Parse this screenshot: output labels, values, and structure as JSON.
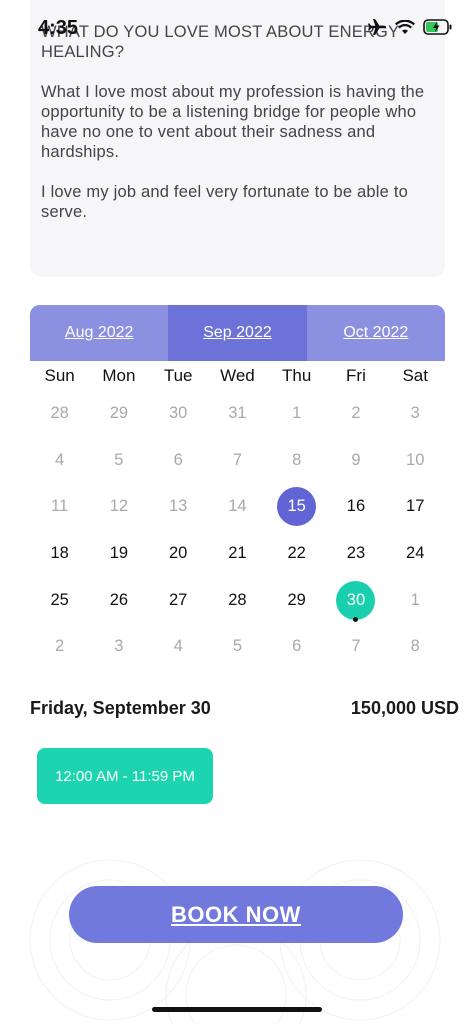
{
  "status": {
    "time": "4:35"
  },
  "bio": {
    "heading": "WHAT DO YOU LOVE MOST ABOUT ENERGY HEALING?",
    "paragraph1": "What I love most about my profession is having the opportunity to be a listening bridge for people who have no one to vent about their sadness and hardships.",
    "paragraph2": "I love my job and feel very fortunate to be able to serve."
  },
  "calendar": {
    "prev_month": "Aug 2022",
    "current_month": "Sep 2022",
    "next_month": "Oct 2022",
    "weekdays": [
      "Sun",
      "Mon",
      "Tue",
      "Wed",
      "Thu",
      "Fri",
      "Sat"
    ],
    "weeks": [
      [
        {
          "d": "28",
          "s": "muted"
        },
        {
          "d": "29",
          "s": "muted"
        },
        {
          "d": "30",
          "s": "muted"
        },
        {
          "d": "31",
          "s": "muted"
        },
        {
          "d": "1",
          "s": "muted"
        },
        {
          "d": "2",
          "s": "muted"
        },
        {
          "d": "3",
          "s": "muted"
        }
      ],
      [
        {
          "d": "4",
          "s": "muted"
        },
        {
          "d": "5",
          "s": "muted"
        },
        {
          "d": "6",
          "s": "muted"
        },
        {
          "d": "7",
          "s": "muted"
        },
        {
          "d": "8",
          "s": "muted"
        },
        {
          "d": "9",
          "s": "muted"
        },
        {
          "d": "10",
          "s": "muted"
        }
      ],
      [
        {
          "d": "11",
          "s": "muted"
        },
        {
          "d": "12",
          "s": "muted"
        },
        {
          "d": "13",
          "s": "muted"
        },
        {
          "d": "14",
          "s": "muted"
        },
        {
          "d": "15",
          "s": "today"
        },
        {
          "d": "16",
          "s": "normal"
        },
        {
          "d": "17",
          "s": "normal"
        }
      ],
      [
        {
          "d": "18",
          "s": "normal"
        },
        {
          "d": "19",
          "s": "normal"
        },
        {
          "d": "20",
          "s": "normal"
        },
        {
          "d": "21",
          "s": "normal"
        },
        {
          "d": "22",
          "s": "normal"
        },
        {
          "d": "23",
          "s": "normal"
        },
        {
          "d": "24",
          "s": "normal"
        }
      ],
      [
        {
          "d": "25",
          "s": "normal"
        },
        {
          "d": "26",
          "s": "normal"
        },
        {
          "d": "27",
          "s": "normal"
        },
        {
          "d": "28",
          "s": "normal"
        },
        {
          "d": "29",
          "s": "normal"
        },
        {
          "d": "30",
          "s": "selected"
        },
        {
          "d": "1",
          "s": "muted"
        }
      ],
      [
        {
          "d": "2",
          "s": "muted"
        },
        {
          "d": "3",
          "s": "muted"
        },
        {
          "d": "4",
          "s": "muted"
        },
        {
          "d": "5",
          "s": "muted"
        },
        {
          "d": "6",
          "s": "muted"
        },
        {
          "d": "7",
          "s": "muted"
        },
        {
          "d": "8",
          "s": "muted"
        }
      ]
    ]
  },
  "booking": {
    "selected_date": "Friday, September 30",
    "price": "150,000 USD",
    "time_slot": "12:00 AM - 11:59 PM",
    "book_label": "BOOK NOW"
  },
  "colors": {
    "accent": "#6c72d8",
    "teal": "#19cfae",
    "muted": "#a9a9a9"
  }
}
